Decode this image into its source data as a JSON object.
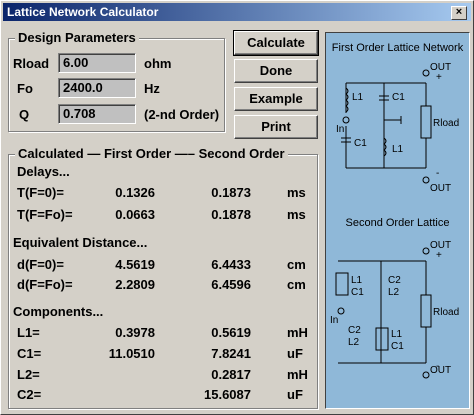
{
  "window": {
    "title": "Lattice Network Calculator",
    "close": "×"
  },
  "design": {
    "title": "Design Parameters",
    "rload": {
      "label": "Rload",
      "value": "6.00",
      "unit": "ohm"
    },
    "fo": {
      "label": "Fo",
      "value": "2400.0",
      "unit": "Hz"
    },
    "q": {
      "label": "Q",
      "value": "0.708",
      "unit": "(2-nd Order)"
    }
  },
  "buttons": {
    "calculate": "Calculate",
    "done": "Done",
    "example": "Example",
    "print": "Print"
  },
  "calc": {
    "title": "Calculated — First Order —– Second Order",
    "delays": {
      "heading": "Delays...",
      "rows": [
        {
          "label": "T(F=0)=",
          "first": "0.1326",
          "second": "0.1873",
          "unit": "ms"
        },
        {
          "label": "T(F=Fo)=",
          "first": "0.0663",
          "second": "0.1878",
          "unit": "ms"
        }
      ]
    },
    "distance": {
      "heading": "Equivalent Distance...",
      "rows": [
        {
          "label": "d(F=0)=",
          "first": "4.5619",
          "second": "6.4433",
          "unit": "cm"
        },
        {
          "label": "d(F=Fo)=",
          "first": "2.2809",
          "second": "6.4596",
          "unit": "cm"
        }
      ]
    },
    "components": {
      "heading": "Components...",
      "rows": [
        {
          "label": "L1=",
          "first": "0.3978",
          "second": "0.5619",
          "unit": "mH"
        },
        {
          "label": "C1=",
          "first": "11.0510",
          "second": "7.8241",
          "unit": "uF"
        },
        {
          "label": "L2=",
          "first": "",
          "second": "0.2817",
          "unit": "mH"
        },
        {
          "label": "C2=",
          "first": "",
          "second": "15.6087",
          "unit": "uF"
        }
      ]
    }
  },
  "schematic": {
    "first_title": "First Order Lattice Network",
    "second_title": "Second Order Lattice",
    "labels": {
      "in": "In",
      "out": "OUT",
      "plus": "+",
      "minus": "-",
      "rload": "Rload",
      "l1": "L1",
      "c1": "C1",
      "l2": "L2",
      "c2": "C2"
    }
  },
  "colors": {
    "panel": "#8fb8d8",
    "title_start": "#0a246a",
    "title_end": "#a6caf0"
  }
}
